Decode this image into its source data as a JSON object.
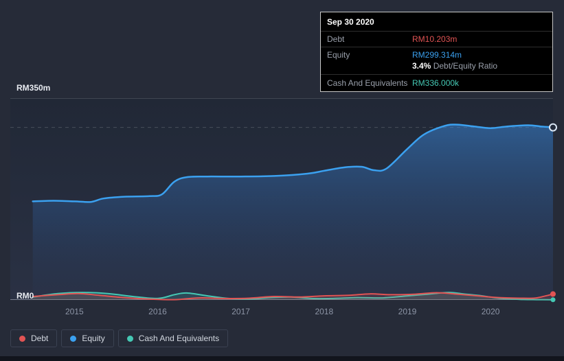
{
  "colors": {
    "background": "#262b38",
    "debt": "#e25454",
    "equity": "#3ba1f0",
    "cash": "#45c8b4",
    "axis_text": "#8d95a6",
    "y_axis_text": "#e8ebf1"
  },
  "tooltip": {
    "date": "Sep 30 2020",
    "debt_label": "Debt",
    "debt_value": "RM10.203m",
    "equity_label": "Equity",
    "equity_value": "RM299.314m",
    "ratio_value": "3.4%",
    "ratio_label": "Debt/Equity Ratio",
    "cash_label": "Cash And Equivalents",
    "cash_value": "RM336.000k"
  },
  "legend": [
    {
      "label": "Debt",
      "color_key": "debt"
    },
    {
      "label": "Equity",
      "color_key": "equity"
    },
    {
      "label": "Cash And Equivalents",
      "color_key": "cash"
    }
  ],
  "chart_data": {
    "type": "area",
    "unit": "RM millions",
    "x_domain": [
      2014.23,
      2020.75
    ],
    "y_domain": [
      0,
      350
    ],
    "x_ticks": [
      2015,
      2016,
      2017,
      2018,
      2019,
      2020
    ],
    "y_tick_labels": {
      "max": "RM350m",
      "min": "RM0"
    },
    "reference_value": 299.314,
    "latest": {
      "date": "Sep 30 2020",
      "debt": 10.203,
      "equity": 299.314,
      "cash": 0.336,
      "debt_equity_ratio_pct": 3.4
    },
    "series": [
      {
        "name": "Equity",
        "color_key": "equity",
        "points": [
          [
            2014.5,
            171
          ],
          [
            2014.75,
            172
          ],
          [
            2015.0,
            171
          ],
          [
            2015.2,
            170
          ],
          [
            2015.35,
            176
          ],
          [
            2015.6,
            179
          ],
          [
            2015.9,
            180
          ],
          [
            2016.05,
            183
          ],
          [
            2016.2,
            205
          ],
          [
            2016.35,
            213
          ],
          [
            2016.6,
            214
          ],
          [
            2017.0,
            214
          ],
          [
            2017.4,
            215
          ],
          [
            2017.8,
            219
          ],
          [
            2018.0,
            224
          ],
          [
            2018.25,
            230
          ],
          [
            2018.45,
            231
          ],
          [
            2018.6,
            225
          ],
          [
            2018.75,
            228
          ],
          [
            2019.0,
            262
          ],
          [
            2019.2,
            287
          ],
          [
            2019.45,
            302
          ],
          [
            2019.6,
            304
          ],
          [
            2019.8,
            301
          ],
          [
            2020.0,
            298
          ],
          [
            2020.2,
            301
          ],
          [
            2020.45,
            303
          ],
          [
            2020.6,
            301
          ],
          [
            2020.75,
            299.314
          ]
        ]
      },
      {
        "name": "Debt",
        "color_key": "debt",
        "points": [
          [
            2014.5,
            6
          ],
          [
            2014.8,
            9
          ],
          [
            2015.05,
            11
          ],
          [
            2015.3,
            8
          ],
          [
            2015.6,
            4
          ],
          [
            2015.9,
            1.5
          ],
          [
            2016.2,
            0.5
          ],
          [
            2016.5,
            3.5
          ],
          [
            2016.8,
            2.5
          ],
          [
            2017.1,
            3
          ],
          [
            2017.4,
            6
          ],
          [
            2017.7,
            5
          ],
          [
            2018.0,
            7
          ],
          [
            2018.3,
            8
          ],
          [
            2018.55,
            10.5
          ],
          [
            2018.8,
            9
          ],
          [
            2019.1,
            10
          ],
          [
            2019.35,
            12.5
          ],
          [
            2019.6,
            10
          ],
          [
            2019.85,
            7
          ],
          [
            2020.1,
            4
          ],
          [
            2020.4,
            3
          ],
          [
            2020.55,
            3.5
          ],
          [
            2020.75,
            10.203
          ]
        ]
      },
      {
        "name": "Cash And Equivalents",
        "color_key": "cash",
        "points": [
          [
            2014.5,
            5
          ],
          [
            2014.8,
            11
          ],
          [
            2015.1,
            13
          ],
          [
            2015.4,
            11
          ],
          [
            2015.7,
            6
          ],
          [
            2016.0,
            2.5
          ],
          [
            2016.2,
            9
          ],
          [
            2016.35,
            12
          ],
          [
            2016.6,
            7
          ],
          [
            2016.85,
            2.5
          ],
          [
            2017.1,
            1.5
          ],
          [
            2017.35,
            4
          ],
          [
            2017.6,
            5
          ],
          [
            2017.85,
            2.5
          ],
          [
            2018.1,
            2.5
          ],
          [
            2018.4,
            4
          ],
          [
            2018.7,
            3.5
          ],
          [
            2019.0,
            7
          ],
          [
            2019.25,
            10
          ],
          [
            2019.5,
            13
          ],
          [
            2019.7,
            10
          ],
          [
            2019.9,
            7
          ],
          [
            2020.1,
            3
          ],
          [
            2020.35,
            1
          ],
          [
            2020.55,
            0.5
          ],
          [
            2020.75,
            0.336
          ]
        ]
      }
    ]
  }
}
